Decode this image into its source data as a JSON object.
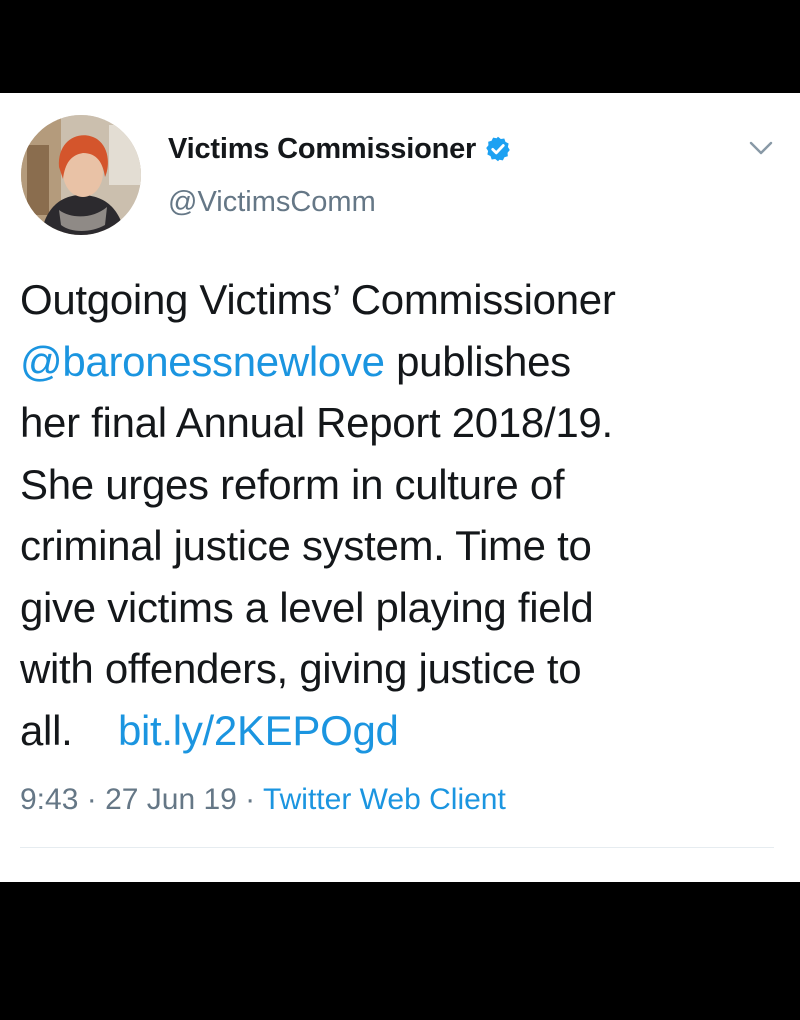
{
  "author": {
    "display_name": "Victims Commissioner",
    "handle": "@VictimsComm",
    "verified": true
  },
  "tweet": {
    "line1": "Outgoing Victims’ Commissioner",
    "mention": "@baronessnewlove",
    "line2_rest": " publishes",
    "line3": "her final Annual Report 2018/19.",
    "line4": "She urges reform in culture of",
    "line5": "criminal justice system. Time to",
    "line6": "give victims a level playing field",
    "line7": "with offenders, giving justice to",
    "line8_start": "all.    ",
    "url": "bit.ly/2KEPOgd"
  },
  "meta": {
    "time": "9:43",
    "sep1": " · ",
    "date": "27 Jun 19",
    "sep2": " · ",
    "source": "Twitter Web Client"
  },
  "icons": {
    "verified": "verified-badge-icon",
    "menu": "chevron-down-icon"
  },
  "colors": {
    "link": "#1b95e0",
    "text": "#14171a",
    "secondary": "#657786"
  }
}
